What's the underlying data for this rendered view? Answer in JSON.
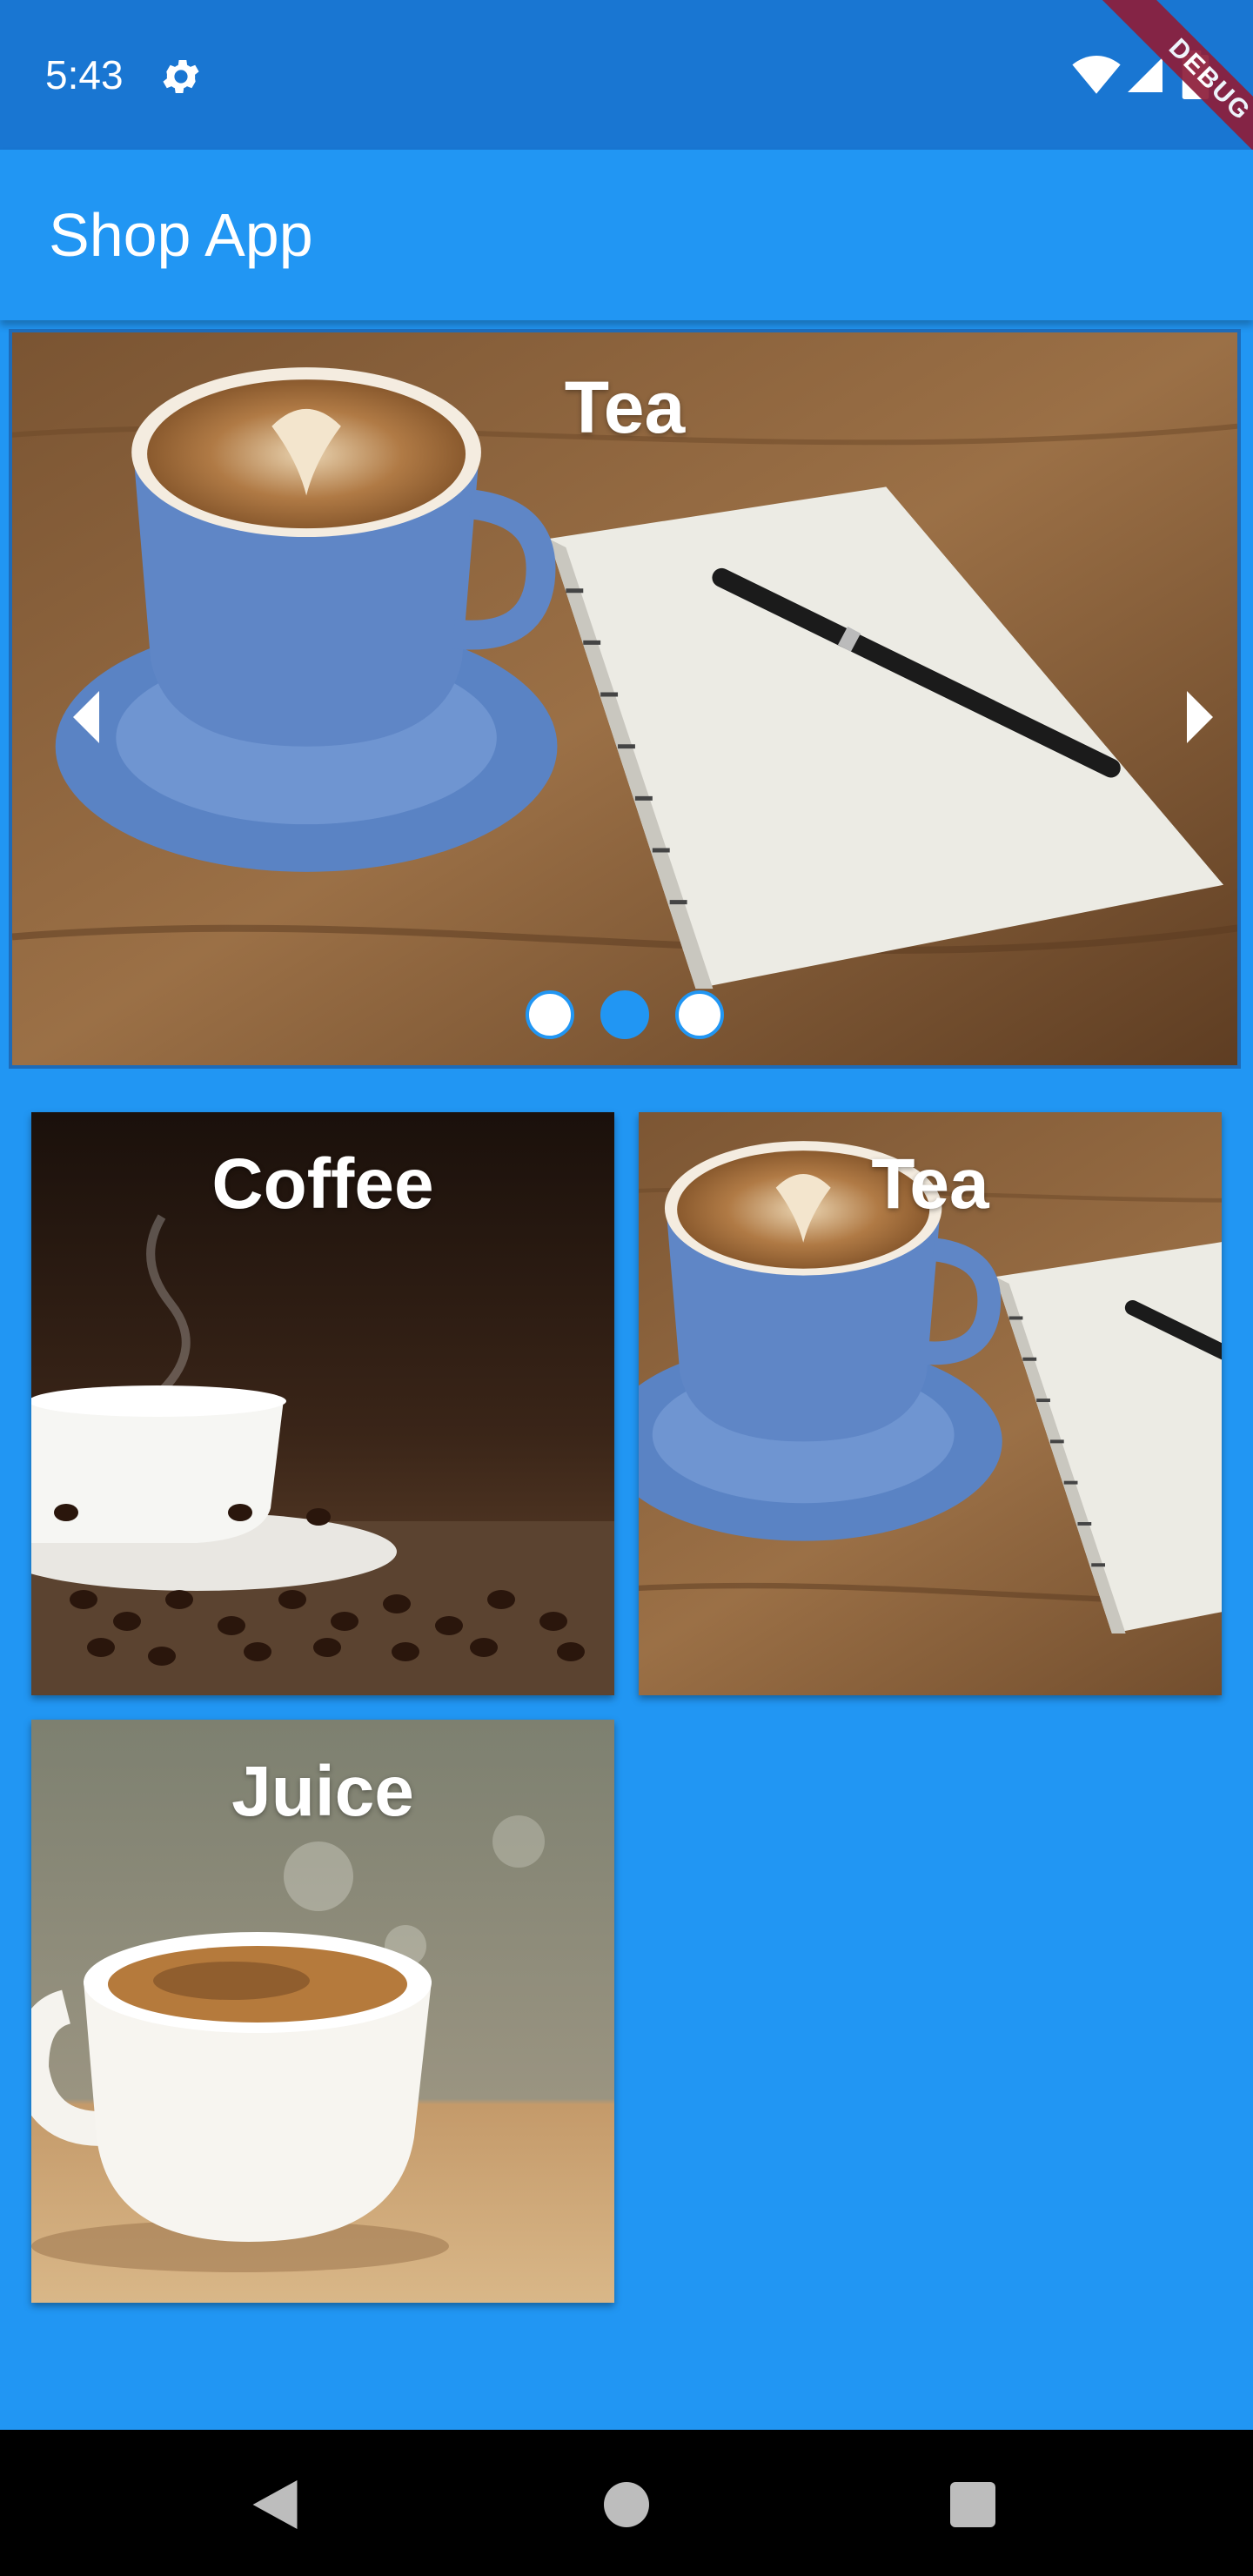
{
  "status_bar": {
    "time": "5:43",
    "debug_label": "DEBUG",
    "icons": [
      "gear-icon",
      "wifi-icon",
      "signal-icon",
      "battery-icon"
    ]
  },
  "app_bar": {
    "title": "Shop App"
  },
  "carousel": {
    "title": "Tea",
    "dot_count": 3,
    "active_dot": 1,
    "icons": [
      "chevron-left-icon",
      "chevron-right-icon"
    ]
  },
  "products": [
    {
      "title": "Coffee"
    },
    {
      "title": "Tea"
    },
    {
      "title": "Juice"
    }
  ],
  "nav_bar": {
    "icons": [
      "back-icon",
      "home-icon",
      "recents-icon"
    ]
  },
  "colors": {
    "primary": "#2196F3",
    "primary_dark": "#1976D2",
    "debug_ribbon": "#8E1E3A"
  }
}
